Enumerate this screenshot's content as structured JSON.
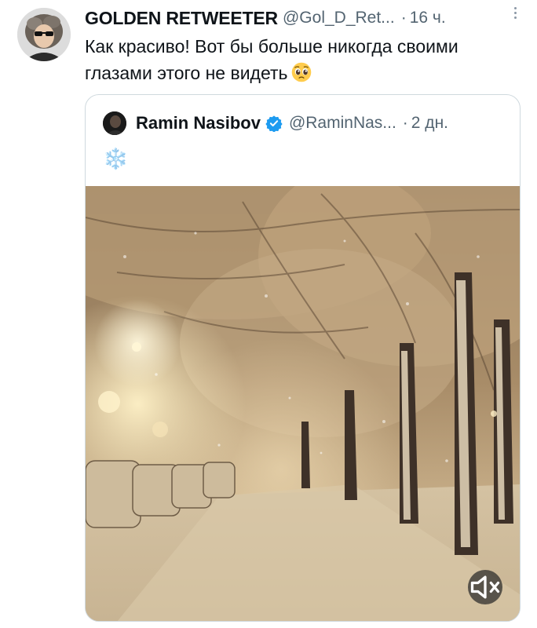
{
  "tweet": {
    "author_name": "GOLDEN RETWEETER",
    "author_handle": "@Gol_D_Ret...",
    "separator": "·",
    "time": "16 ч.",
    "text": "Как красиво! Вот бы больше никогда своими глазами этого не видеть",
    "emoji": "pleading-face-emoji",
    "more_icon": "more-dots-icon"
  },
  "quote": {
    "author_name": "Ramin Nasibov",
    "author_handle": "@RaminNas...",
    "separator": "·",
    "time": "2 дн.",
    "text": "❄️",
    "verified_icon": "verified-badge-icon",
    "media_description": "snowy-street-night-video",
    "mute_icon": "volume-muted-icon"
  },
  "colors": {
    "text_primary": "#0f1419",
    "text_secondary": "#536471",
    "border": "#cfd9de",
    "verified": "#1d9bf0",
    "snowflake": "#7ab6e8"
  }
}
